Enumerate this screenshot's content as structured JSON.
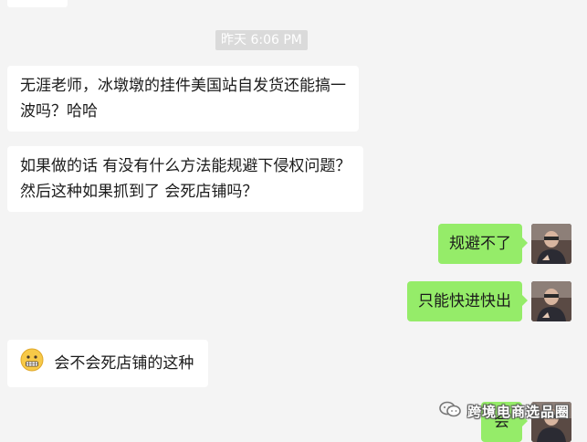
{
  "timestamp": "昨天 6:06 PM",
  "messages": [
    {
      "side": "left",
      "text": "无涯老师，冰墩墩的挂件美国站自发货还能搞一波吗？哈哈"
    },
    {
      "side": "left",
      "text": "如果做的话 有没有什么方法能规避下侵权问题？然后这种如果抓到了 会死店铺吗？"
    },
    {
      "side": "right",
      "text": "规避不了"
    },
    {
      "side": "right",
      "text": "只能快进快出"
    },
    {
      "side": "left",
      "emoji": "grimace-face-icon",
      "text": "会不会死店铺的这种"
    },
    {
      "side": "right",
      "text": "会"
    }
  ],
  "watermark": {
    "text": "跨境电商选品圈",
    "icon": "wechat-channel-icon"
  },
  "colors": {
    "background": "#f4f4f4",
    "left_bubble": "#ffffff",
    "right_bubble": "#95ec69",
    "timestamp_bg": "#dadada"
  }
}
